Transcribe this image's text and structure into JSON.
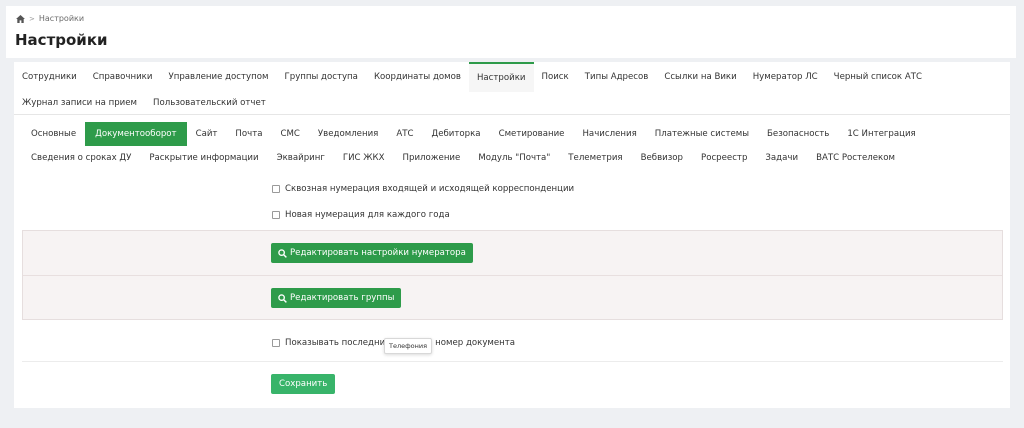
{
  "breadcrumb": {
    "home_icon": "home-icon",
    "separator": ">",
    "current": "Настройки"
  },
  "page_title": "Настройки",
  "main_tabs_row1": [
    "Сотрудники",
    "Справочники",
    "Управление доступом",
    "Группы доступа",
    "Координаты домов",
    "Настройки",
    "Поиск",
    "Типы Адресов",
    "Ссылки на Вики",
    "Нумератор ЛС",
    "Черный список АТС"
  ],
  "main_tabs_row2": [
    "Журнал записи на прием",
    "Пользовательский отчет"
  ],
  "active_main_tab": "Настройки",
  "sub_tabs_row1": [
    "Основные",
    "Документооборот",
    "Сайт",
    "Почта",
    "СМС",
    "Уведомления",
    "АТС",
    "Дебиторка",
    "Сметирование",
    "Начисления",
    "Платежные системы",
    "Безопасность",
    "1С Интеграция"
  ],
  "sub_tabs_row2": [
    "Сведения о сроках ДУ",
    "Раскрытие информации",
    "Эквайринг",
    "ГИС ЖКХ",
    "Приложение",
    "Модуль \"Почта\"",
    "Телеметрия",
    "Вебвизор",
    "Росреестр",
    "Задачи",
    "ВАТС Ростелеком"
  ],
  "active_sub_tab": "Документооборот",
  "options": {
    "through_numbering": "Сквозная нумерация входящей и исходящей корреспонденции",
    "new_numbering_each_year": "Новая нумерация для каждого года",
    "show_last_number": "Показывать последний номер документа",
    "show_last_number_left": "Показывать последни",
    "show_last_number_right": "ий номер документа"
  },
  "buttons": {
    "edit_numerator": "Редактировать настройки нумератора",
    "edit_groups": "Редактировать группы",
    "save": "Сохранить"
  },
  "tooltip": "Телефония",
  "colors": {
    "accent": "#2e9b4a",
    "save": "#38b46a",
    "background": "#eef0f3"
  }
}
